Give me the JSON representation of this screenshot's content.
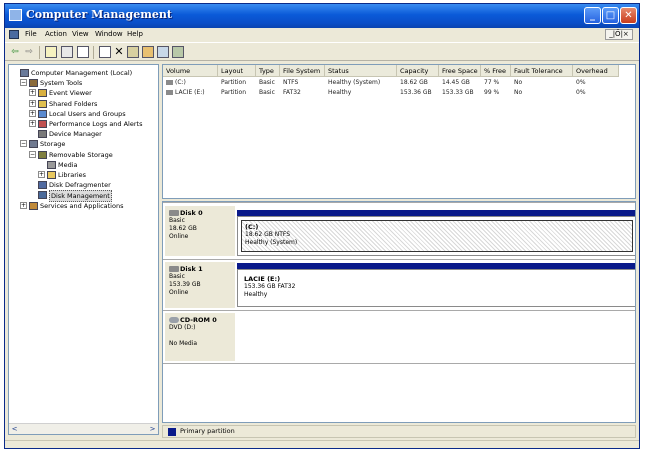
{
  "window": {
    "title": "Computer Management",
    "min_glyph": "_",
    "max_glyph": "□",
    "close_glyph": "✕"
  },
  "menu": {
    "items": [
      "File",
      "Action",
      "View",
      "Window",
      "Help"
    ],
    "mdi_controls": "_|Ő|×"
  },
  "toolbar": {
    "icons": [
      "back-arrow-icon",
      "forward-arrow-icon",
      "up-folder-icon",
      "show-hide-tree-icon",
      "properties-icon",
      "help-icon",
      "delete-icon",
      "connect-icon",
      "open-icon",
      "search-icon",
      "magnify-icon"
    ],
    "back_glyph": "⇦",
    "forward_glyph": "⇨",
    "delete_glyph": "✕"
  },
  "tree": {
    "items": [
      {
        "label": "Computer Management (Local)",
        "depth": 0,
        "expander": "",
        "icon": "computer-management-icon"
      },
      {
        "label": "System Tools",
        "depth": 1,
        "expander": "−",
        "icon": "system-tools-icon"
      },
      {
        "label": "Event Viewer",
        "depth": 2,
        "expander": "+",
        "icon": "event-viewer-icon"
      },
      {
        "label": "Shared Folders",
        "depth": 2,
        "expander": "+",
        "icon": "shared-folders-icon"
      },
      {
        "label": "Local Users and Groups",
        "depth": 2,
        "expander": "+",
        "icon": "users-icon"
      },
      {
        "label": "Performance Logs and Alerts",
        "depth": 2,
        "expander": "+",
        "icon": "performance-icon"
      },
      {
        "label": "Device Manager",
        "depth": 2,
        "expander": "",
        "icon": "device-manager-icon"
      },
      {
        "label": "Storage",
        "depth": 1,
        "expander": "−",
        "icon": "storage-icon"
      },
      {
        "label": "Removable Storage",
        "depth": 2,
        "expander": "−",
        "icon": "removable-storage-icon"
      },
      {
        "label": "Media",
        "depth": 3,
        "expander": "",
        "icon": "media-icon"
      },
      {
        "label": "Libraries",
        "depth": 3,
        "expander": "+",
        "icon": "libraries-folder-icon"
      },
      {
        "label": "Disk Defragmenter",
        "depth": 2,
        "expander": "",
        "icon": "defragmenter-icon"
      },
      {
        "label": "Disk Management",
        "depth": 2,
        "expander": "",
        "icon": "disk-management-icon",
        "selected": true
      },
      {
        "label": "Services and Applications",
        "depth": 1,
        "expander": "+",
        "icon": "services-icon"
      }
    ],
    "scroll_left": "<",
    "scroll_right": ">"
  },
  "volumes": {
    "columns": [
      "Volume",
      "Layout",
      "Type",
      "File System",
      "Status",
      "Capacity",
      "Free Space",
      "% Free",
      "Fault Tolerance",
      "Overhead"
    ],
    "rows": [
      [
        "(C:)",
        "Partition",
        "Basic",
        "NTFS",
        "Healthy (System)",
        "18.62 GB",
        "14.45 GB",
        "77 %",
        "No",
        "0%"
      ],
      [
        "LACIE (E:)",
        "Partition",
        "Basic",
        "FAT32",
        "Healthy",
        "153.36 GB",
        "153.33 GB",
        "99 %",
        "No",
        "0%"
      ]
    ]
  },
  "disks": [
    {
      "name": "Disk 0",
      "type": "Basic",
      "size": "18.62 GB",
      "state": "Online",
      "partition": {
        "name": "(C:)",
        "detail": "18.62 GB NTFS",
        "status": "Healthy (System)"
      }
    },
    {
      "name": "Disk 1",
      "type": "Basic",
      "size": "153.39 GB",
      "state": "Online",
      "partition": {
        "name": "LACIE (E:)",
        "detail": "153.36 GB FAT32",
        "status": "Healthy"
      }
    },
    {
      "name": "CD-ROM 0",
      "type": "DVD (D:)",
      "size": "",
      "state": "No Media"
    }
  ],
  "legend": {
    "label": "Primary partition",
    "color": "#0a1a8a"
  }
}
